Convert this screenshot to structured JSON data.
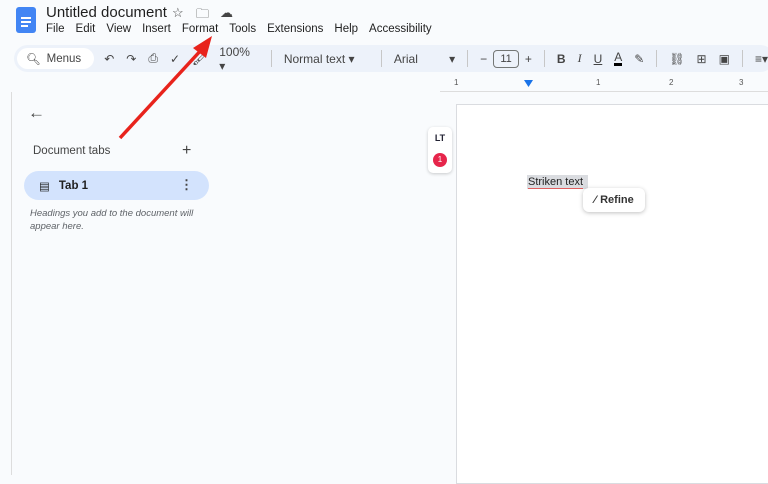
{
  "app": {
    "title": "Untitled document"
  },
  "menu": [
    "File",
    "Edit",
    "View",
    "Insert",
    "Format",
    "Tools",
    "Extensions",
    "Help",
    "Accessibility"
  ],
  "toolbar": {
    "search": "Menus",
    "zoom": "100%",
    "style": "Normal text",
    "font": "Arial",
    "font_size": "11"
  },
  "ruler": {
    "labels": [
      "1",
      "1",
      "2",
      "3"
    ]
  },
  "sidebar": {
    "heading": "Document tabs",
    "tab": "Tab 1",
    "hint": "Headings you add to the document will appear here."
  },
  "document": {
    "text": "Striken text",
    "refine": "Refine",
    "lt_badge": "1"
  },
  "annotation": {
    "arrow_color": "#e8231c"
  }
}
